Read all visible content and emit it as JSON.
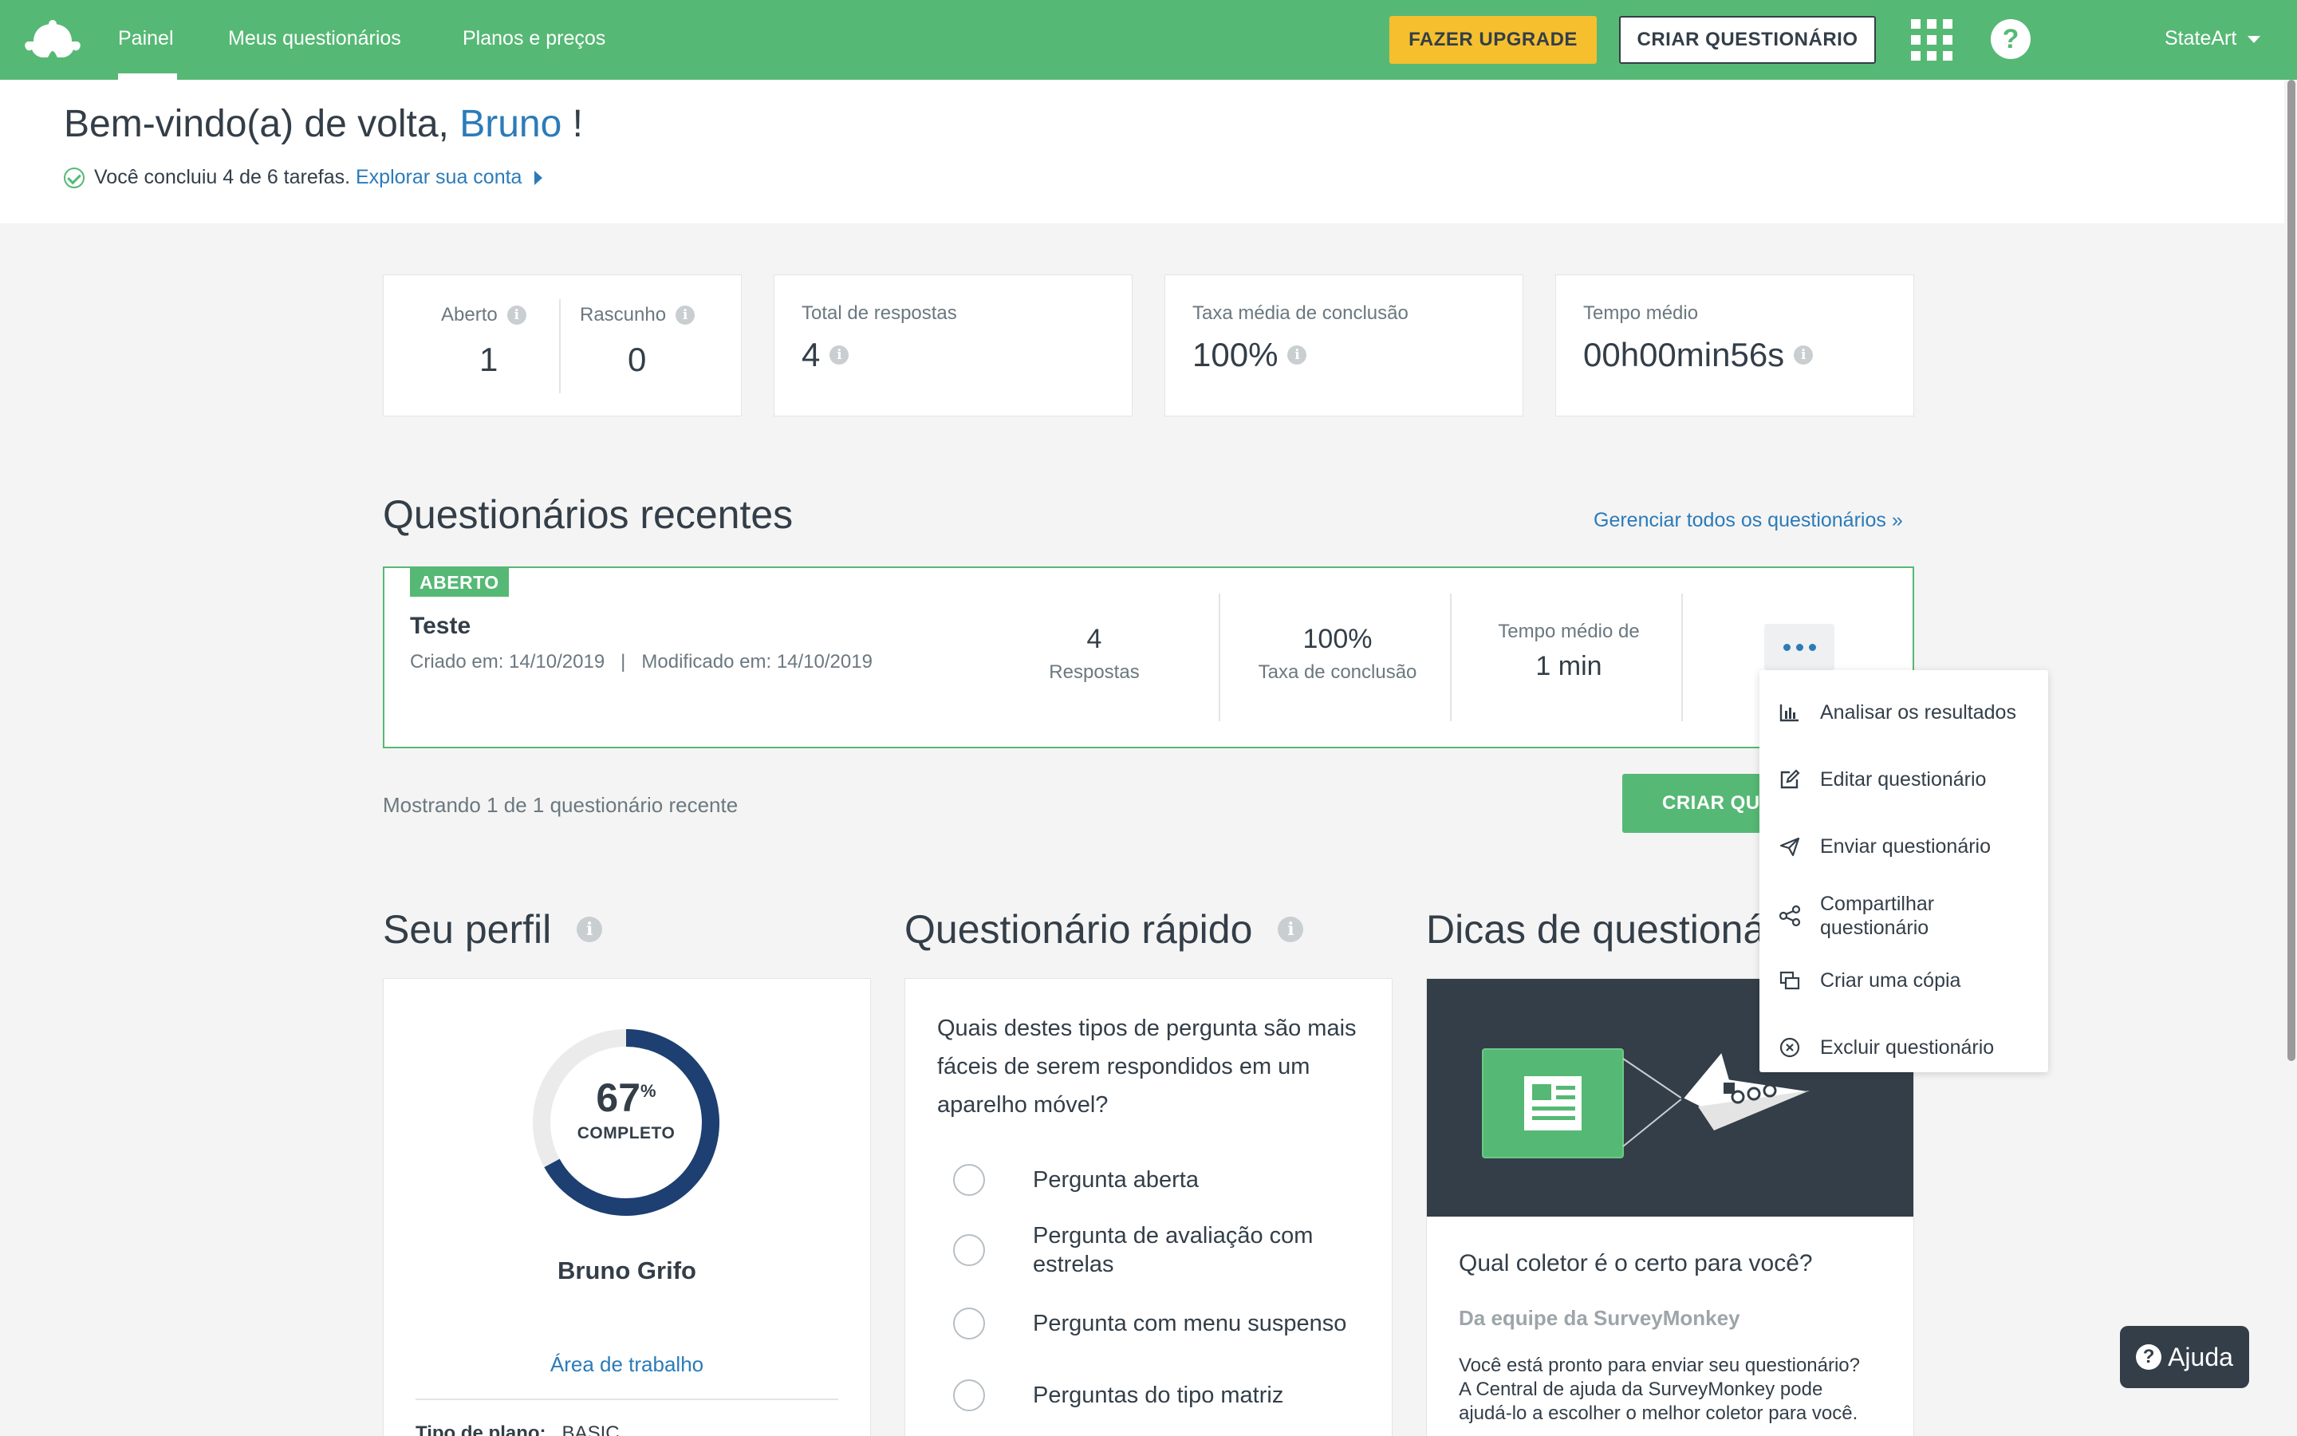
{
  "nav": {
    "links": [
      "Painel",
      "Meus questionários",
      "Planos e preços"
    ],
    "upgrade_label": "FAZER UPGRADE",
    "create_label": "CRIAR QUESTIONÁRIO",
    "user": "StateArt"
  },
  "welcome": {
    "greeting": "Bem-vindo(a) de volta,",
    "name": "Bruno",
    "exclaim": "!",
    "tasks_text": "Você concluiu 4 de 6 tarefas.",
    "tasks_link": "Explorar sua conta"
  },
  "stats": {
    "open_label": "Aberto",
    "open_value": "1",
    "draft_label": "Rascunho",
    "draft_value": "0",
    "responses_label": "Total de respostas",
    "responses_value": "4",
    "completion_label": "Taxa média de conclusão",
    "completion_value": "100%",
    "time_label": "Tempo médio",
    "time_value": "00h00min56s"
  },
  "recent": {
    "title": "Questionários recentes",
    "manage_link": "Gerenciar todos os questionários »",
    "survey": {
      "status": "ABERTO",
      "name": "Teste",
      "created": "Criado em: 14/10/2019",
      "separator": "|",
      "modified": "Modificado em: 14/10/2019",
      "responses_value": "4",
      "responses_label": "Respostas",
      "completion_value": "100%",
      "completion_label": "Taxa de conclusão",
      "time_label": "Tempo médio de",
      "time_value": "1 min"
    },
    "showing": "Mostrando 1 de 1 questionário recente",
    "create_button": "CRIAR QUESTIONÁRIO"
  },
  "dropdown": {
    "items": [
      {
        "label": "Analisar os resultados",
        "icon": "bar-chart-icon"
      },
      {
        "label": "Editar questionário",
        "icon": "edit-icon"
      },
      {
        "label": "Enviar questionário",
        "icon": "send-icon"
      },
      {
        "label": "Compartilhar questionário",
        "icon": "share-icon"
      },
      {
        "label": "Criar uma cópia",
        "icon": "copy-icon"
      },
      {
        "label": "Excluir questionário",
        "icon": "delete-icon"
      }
    ]
  },
  "profile": {
    "title": "Seu perfil",
    "percent": "67",
    "percent_sign": "%",
    "progress": 0.67,
    "complete_label": "COMPLETO",
    "name": "Bruno Grifo",
    "workspace_link": "Área de trabalho",
    "plan_label": "Tipo de plano:",
    "plan_value": "BASIC"
  },
  "quick": {
    "title": "Questionário rápido",
    "question": "Quais destes tipos de pergunta são mais fáceis de serem respondidos em um aparelho móvel?",
    "options": [
      "Pergunta aberta",
      "Pergunta de avaliação com estrelas",
      "Pergunta com menu suspenso",
      "Perguntas do tipo matriz"
    ]
  },
  "tips": {
    "title": "Dicas de questionários",
    "article_title": "Qual coletor é o certo para você?",
    "author": "Da equipe da SurveyMonkey",
    "body": "Você está pronto para enviar seu questionário? A Central de ajuda da SurveyMonkey pode ajudá-lo a escolher o melhor coletor para você."
  },
  "help_button": "Ajuda",
  "colors": {
    "brand_green": "#56b875",
    "upgrade_yellow": "#f5bf2e",
    "link_blue": "#2b7bb9",
    "text_dark": "#333e48",
    "donut_blue": "#1d3f72"
  }
}
